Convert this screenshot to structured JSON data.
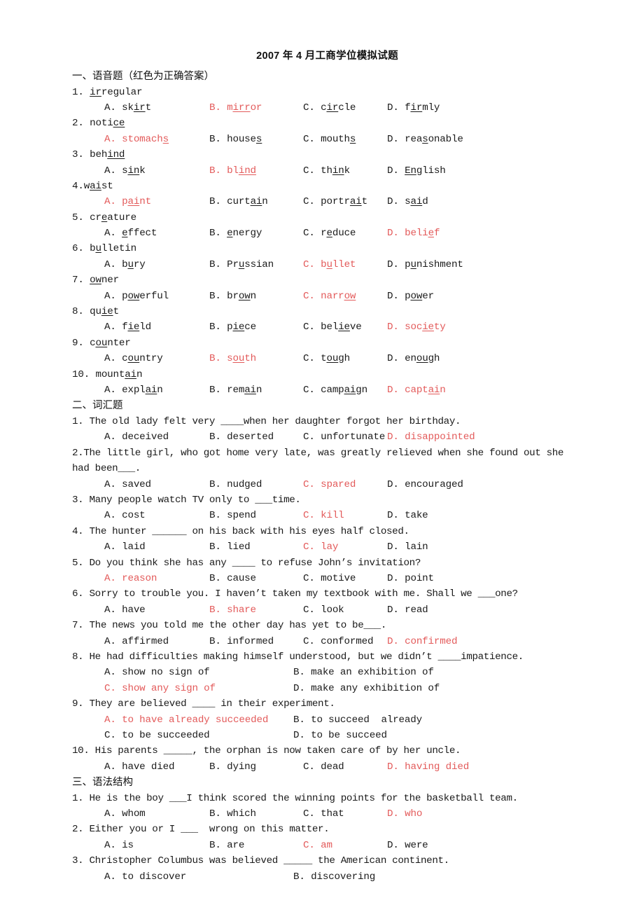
{
  "document": {
    "title": "2007 年 4 月工商学位模拟试题",
    "answer_color": "#e35a5a"
  },
  "sections": [
    {
      "heading": "一、语音题（红色为正确答案）",
      "questions": [
        {
          "number": "1.",
          "stem_pre": " ",
          "stem_underline": "ir",
          "stem_post": "regular",
          "options": [
            {
              "letter": "A.",
              "pre": "sk",
              "mid": "ir",
              "post": "t",
              "correct": false
            },
            {
              "letter": "B.",
              "pre": "m",
              "mid": "irr",
              "post": "or",
              "correct": true
            },
            {
              "letter": "C.",
              "pre": "c",
              "mid": "ir",
              "post": "cle",
              "correct": false
            },
            {
              "letter": "D.",
              "pre": "f",
              "mid": "ir",
              "post": "mly",
              "correct": false
            }
          ]
        },
        {
          "number": "2.",
          "stem_pre": " noti",
          "stem_underline": "ce",
          "stem_post": "",
          "options": [
            {
              "letter": "A.",
              "pre": "stomach",
              "mid": "s",
              "post": "",
              "correct": true
            },
            {
              "letter": "B.",
              "pre": "house",
              "mid": "s",
              "post": "",
              "correct": false
            },
            {
              "letter": "C.",
              "pre": "mouth",
              "mid": "s",
              "post": "",
              "correct": false
            },
            {
              "letter": "D.",
              "pre": "rea",
              "mid": "s",
              "post": "onable",
              "correct": false
            }
          ]
        },
        {
          "number": "3.",
          "stem_pre": " beh",
          "stem_underline": "ind",
          "stem_post": "",
          "options": [
            {
              "letter": "A.",
              "pre": "s",
              "mid": "in",
              "post": "k",
              "correct": false
            },
            {
              "letter": "B.",
              "pre": "bl",
              "mid": "ind",
              "post": "",
              "correct": true
            },
            {
              "letter": "C.",
              "pre": "th",
              "mid": "in",
              "post": "k",
              "correct": false
            },
            {
              "letter": "D.",
              "pre": "",
              "mid": "En",
              "post": "glish",
              "correct": false
            }
          ]
        },
        {
          "number": "4.",
          "stem_pre": "w",
          "stem_underline": "ai",
          "stem_post": "st",
          "options": [
            {
              "letter": "A.",
              "pre": "p",
              "mid": "ai",
              "post": "nt",
              "correct": true
            },
            {
              "letter": "B.",
              "pre": "curt",
              "mid": "ai",
              "post": "n",
              "correct": false
            },
            {
              "letter": "C.",
              "pre": "portr",
              "mid": "ai",
              "post": "t",
              "correct": false
            },
            {
              "letter": "D.",
              "pre": "s",
              "mid": "ai",
              "post": "d",
              "correct": false
            }
          ]
        },
        {
          "number": "5.",
          "stem_pre": " cr",
          "stem_underline": "e",
          "stem_post": "ature",
          "options": [
            {
              "letter": "A.",
              "pre": "",
              "mid": "e",
              "post": "ffect",
              "correct": false
            },
            {
              "letter": "B.",
              "pre": "",
              "mid": "e",
              "post": "nergy",
              "correct": false
            },
            {
              "letter": "C.",
              "pre": "r",
              "mid": "e",
              "post": "duce",
              "correct": false
            },
            {
              "letter": "D.",
              "pre": "beli",
              "mid": "e",
              "post": "f",
              "correct": true
            }
          ]
        },
        {
          "number": "6.",
          "stem_pre": " b",
          "stem_underline": "u",
          "stem_post": "lletin",
          "options": [
            {
              "letter": "A.",
              "pre": "b",
              "mid": "u",
              "post": "ry",
              "correct": false
            },
            {
              "letter": "B.",
              "pre": "Pr",
              "mid": "u",
              "post": "ssian",
              "correct": false
            },
            {
              "letter": "C.",
              "pre": "b",
              "mid": "u",
              "post": "llet",
              "correct": true
            },
            {
              "letter": "D.",
              "pre": "p",
              "mid": "u",
              "post": "nishment",
              "correct": false
            }
          ]
        },
        {
          "number": "7.",
          "stem_pre": " ",
          "stem_underline": "ow",
          "stem_post": "ner",
          "options": [
            {
              "letter": "A.",
              "pre": "p",
              "mid": "ow",
              "post": "erful",
              "correct": false
            },
            {
              "letter": "B.",
              "pre": "br",
              "mid": "ow",
              "post": "n",
              "correct": false
            },
            {
              "letter": "C.",
              "pre": "narr",
              "mid": "ow",
              "post": "",
              "correct": true
            },
            {
              "letter": "D.",
              "pre": "p",
              "mid": "ow",
              "post": "er",
              "correct": false
            }
          ]
        },
        {
          "number": "8.",
          "stem_pre": " qu",
          "stem_underline": "ie",
          "stem_post": "t",
          "options": [
            {
              "letter": "A.",
              "pre": "f",
              "mid": "ie",
              "post": "ld",
              "correct": false
            },
            {
              "letter": "B.",
              "pre": "p",
              "mid": "ie",
              "post": "ce",
              "correct": false
            },
            {
              "letter": "C.",
              "pre": "bel",
              "mid": "ie",
              "post": "ve",
              "correct": false
            },
            {
              "letter": "D.",
              "pre": "soc",
              "mid": "ie",
              "post": "ty",
              "correct": true
            }
          ]
        },
        {
          "number": "9.",
          "stem_pre": " c",
          "stem_underline": "ou",
          "stem_post": "nter",
          "options": [
            {
              "letter": "A.",
              "pre": "c",
              "mid": "ou",
              "post": "ntry",
              "correct": false
            },
            {
              "letter": "B.",
              "pre": "s",
              "mid": "ou",
              "post": "th",
              "correct": true
            },
            {
              "letter": "C.",
              "pre": "t",
              "mid": "ou",
              "post": "gh",
              "correct": false
            },
            {
              "letter": "D.",
              "pre": "en",
              "mid": "ou",
              "post": "gh",
              "correct": false
            }
          ]
        },
        {
          "number": "10.",
          "stem_pre": " mount",
          "stem_underline": "ai",
          "stem_post": "n",
          "options": [
            {
              "letter": "A.",
              "pre": "expl",
              "mid": "ai",
              "post": "n",
              "correct": false
            },
            {
              "letter": "B.",
              "pre": "rem",
              "mid": "ai",
              "post": "n",
              "correct": false
            },
            {
              "letter": "C.",
              "pre": "camp",
              "mid": "ai",
              "post": "gn",
              "correct": false
            },
            {
              "letter": "D.",
              "pre": "capt",
              "mid": "ai",
              "post": "n",
              "correct": true
            }
          ]
        }
      ]
    },
    {
      "heading": "二、词汇题",
      "questions": [
        {
          "number": "1.",
          "stem": "1. The old lady felt very ____when her daughter forgot her birthday.",
          "layout": "four",
          "options": [
            {
              "label": "A. deceived",
              "correct": false
            },
            {
              "label": "B. deserted",
              "correct": false
            },
            {
              "label": "C. unfortunate",
              "correct": false
            },
            {
              "label": "D. disappointed",
              "correct": true
            }
          ]
        },
        {
          "number": "2.",
          "stem": "2.The little girl, who got home very late, was greatly relieved when she found out she had been___.",
          "layout": "four",
          "options": [
            {
              "label": "A. saved",
              "correct": false
            },
            {
              "label": "B. nudged",
              "correct": false
            },
            {
              "label": "C. spared",
              "correct": true
            },
            {
              "label": "D. encouraged",
              "correct": false
            }
          ]
        },
        {
          "number": "3.",
          "stem": "3. Many people watch TV only to ___time.",
          "layout": "four",
          "options": [
            {
              "label": "A. cost",
              "correct": false
            },
            {
              "label": "B. spend",
              "correct": false
            },
            {
              "label": "C. kill",
              "correct": true
            },
            {
              "label": "D. take",
              "correct": false
            }
          ]
        },
        {
          "number": "4.",
          "stem": "4. The hunter ______ on his back with his eyes half closed.",
          "layout": "four",
          "options": [
            {
              "label": "A. laid",
              "correct": false
            },
            {
              "label": "B. lied",
              "correct": false
            },
            {
              "label": "C. lay",
              "correct": true
            },
            {
              "label": "D. lain",
              "correct": false
            }
          ]
        },
        {
          "number": "5.",
          "stem": "5. Do you think she has any ____ to refuse John’s invitation?",
          "layout": "four",
          "options": [
            {
              "label": "A. reason",
              "correct": true
            },
            {
              "label": "B. cause",
              "correct": false
            },
            {
              "label": "C. motive",
              "correct": false
            },
            {
              "label": "D. point",
              "correct": false
            }
          ]
        },
        {
          "number": "6.",
          "stem": "6. Sorry to trouble you. I haven’t taken my textbook with me. Shall we ___one?",
          "layout": "four",
          "options": [
            {
              "label": "A. have",
              "correct": false
            },
            {
              "label": "B. share",
              "correct": true
            },
            {
              "label": "C. look",
              "correct": false
            },
            {
              "label": "D. read",
              "correct": false
            }
          ]
        },
        {
          "number": "7.",
          "stem": "7. The news you told me the other day has yet to be___.",
          "layout": "four",
          "options": [
            {
              "label": "A. affirmed",
              "correct": false
            },
            {
              "label": "B. informed",
              "correct": false
            },
            {
              "label": "C. conformed",
              "correct": false
            },
            {
              "label": "D. confirmed",
              "correct": true
            }
          ]
        },
        {
          "number": "8.",
          "stem": "8. He had difficulties making himself understood, but we didn’t ____impatience.",
          "layout": "two",
          "options": [
            {
              "label": "A. show no sign of",
              "correct": false
            },
            {
              "label": "B. make an exhibition of",
              "correct": false
            },
            {
              "label": "C. show any sign of",
              "correct": true
            },
            {
              "label": "D. make any exhibition of",
              "correct": false
            }
          ]
        },
        {
          "number": "9.",
          "stem": "9. They are believed ____ in their experiment.",
          "layout": "two",
          "options": [
            {
              "label": "A. to have already succeeded",
              "correct": true
            },
            {
              "label": "B. to succeed  already",
              "correct": false
            },
            {
              "label": "C. to be succeeded",
              "correct": false
            },
            {
              "label": "D. to be succeed",
              "correct": false
            }
          ]
        },
        {
          "number": "10.",
          "stem": "10. His parents _____, the orphan is now taken care of by her uncle.",
          "layout": "four",
          "options": [
            {
              "label": "A. have died",
              "correct": false
            },
            {
              "label": "B. dying",
              "correct": false
            },
            {
              "label": "C. dead",
              "correct": false
            },
            {
              "label": "D. having died",
              "correct": true
            }
          ]
        }
      ]
    },
    {
      "heading": "三、语法结构",
      "questions": [
        {
          "number": "1.",
          "stem": "1. He is the boy ___I think scored the winning points for the basketball team.",
          "layout": "four",
          "options": [
            {
              "label": "A. whom",
              "correct": false
            },
            {
              "label": "B. which",
              "correct": false
            },
            {
              "label": "C. that",
              "correct": false
            },
            {
              "label": "D. who",
              "correct": true
            }
          ]
        },
        {
          "number": "2.",
          "stem": "2. Either you or I ___  wrong on this matter.",
          "layout": "four",
          "options": [
            {
              "label": "A. is",
              "correct": false
            },
            {
              "label": "B. are",
              "correct": false
            },
            {
              "label": "C. am",
              "correct": true
            },
            {
              "label": "D. were",
              "correct": false
            }
          ]
        },
        {
          "number": "3.",
          "stem": "3. Christopher Columbus was believed _____ the American continent.",
          "layout": "two-partial",
          "options": [
            {
              "label": "A. to discover",
              "correct": false
            },
            {
              "label": "B. discovering",
              "correct": false
            }
          ]
        }
      ]
    }
  ]
}
